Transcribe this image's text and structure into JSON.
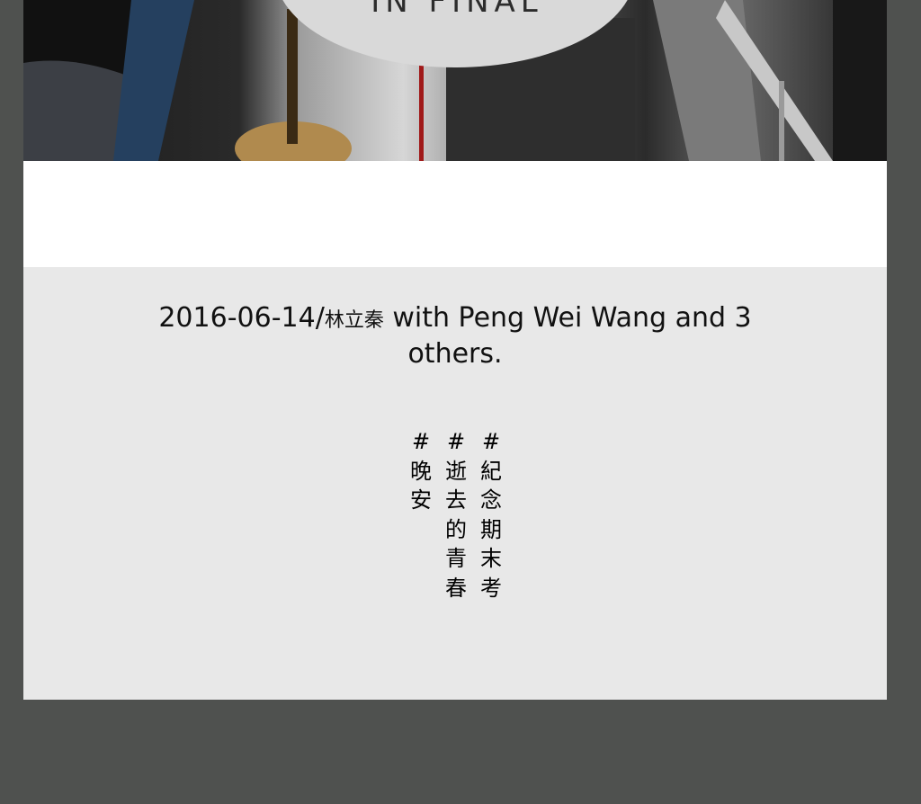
{
  "photo": {
    "caption": "IN FINAL",
    "alt": "photo banner"
  },
  "post": {
    "date": "2016-06-14",
    "separator": "/",
    "author": "林立秦",
    "with_text": " with Peng Wei Wang and 3 others.",
    "tags": [
      "#晚安",
      "#逝去的青春",
      "#紀念期末考"
    ]
  },
  "colors": {
    "outer_background": "#4f514f",
    "post_background": "#e8e8e8",
    "page_background": "#ffffff"
  }
}
